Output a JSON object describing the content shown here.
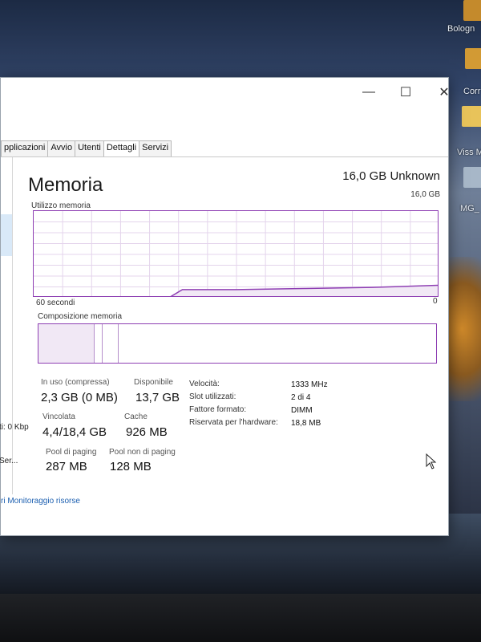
{
  "desktop": {
    "icon_labels": [
      "Bologn",
      "Corr",
      "Viss M",
      "MG_"
    ]
  },
  "window": {
    "controls": {
      "minimize": "—",
      "maximize": "☐",
      "close": "✕"
    },
    "tabs": [
      "pplicazioni",
      "Avvio",
      "Utenti",
      "Dettagli",
      "Servizi"
    ],
    "active_tab": "Dettagli",
    "sidebar": {
      "net_label": "ti: 0 Kbp",
      "service_label": "Ser..."
    },
    "footer_link": "ri Monitoraggio risorse"
  },
  "memory": {
    "title": "Memoria",
    "total": "16,0 GB Unknown",
    "graph": {
      "label": "Utilizzo memoria",
      "max_label": "16,0 GB",
      "x_left": "60 secondi",
      "x_right": "0"
    },
    "composition_label": "Composizione memoria",
    "composition": {
      "in_use_fraction": 0.14,
      "modified_fraction": 0.02,
      "standby_fraction": 0.04
    },
    "stats": {
      "in_use_label": "In uso (compressa)",
      "in_use_value": "2,3 GB (0 MB)",
      "available_label": "Disponibile",
      "available_value": "13,7 GB",
      "committed_label": "Vincolata",
      "committed_value": "4,4/18,4 GB",
      "cache_label": "Cache",
      "cache_value": "926 MB",
      "paged_label": "Pool di paging",
      "paged_value": "287 MB",
      "nonpaged_label": "Pool non di paging",
      "nonpaged_value": "128 MB"
    },
    "properties": [
      {
        "label": "Velocità:",
        "value": "1333 MHz"
      },
      {
        "label": "Slot utilizzati:",
        "value": "2 di 4"
      },
      {
        "label": "Fattore formato:",
        "value": "DIMM"
      },
      {
        "label": "Riservata per l'hardware:",
        "value": "18,8 MB"
      }
    ]
  },
  "chart_data": {
    "type": "line",
    "title": "Utilizzo memoria",
    "xlabel": "",
    "ylabel": "",
    "x": [
      60,
      40,
      38,
      35,
      30,
      20,
      10,
      0
    ],
    "series": [
      {
        "values": [
          null,
          0,
          1.5,
          1.5,
          1.5,
          1.7,
          1.9,
          2.3
        ]
      }
    ],
    "xlim": [
      60,
      0
    ],
    "ylim": [
      0,
      16
    ],
    "grid": true
  },
  "colors": {
    "accent": "#8e3fb3",
    "link": "#1c5fb0"
  }
}
